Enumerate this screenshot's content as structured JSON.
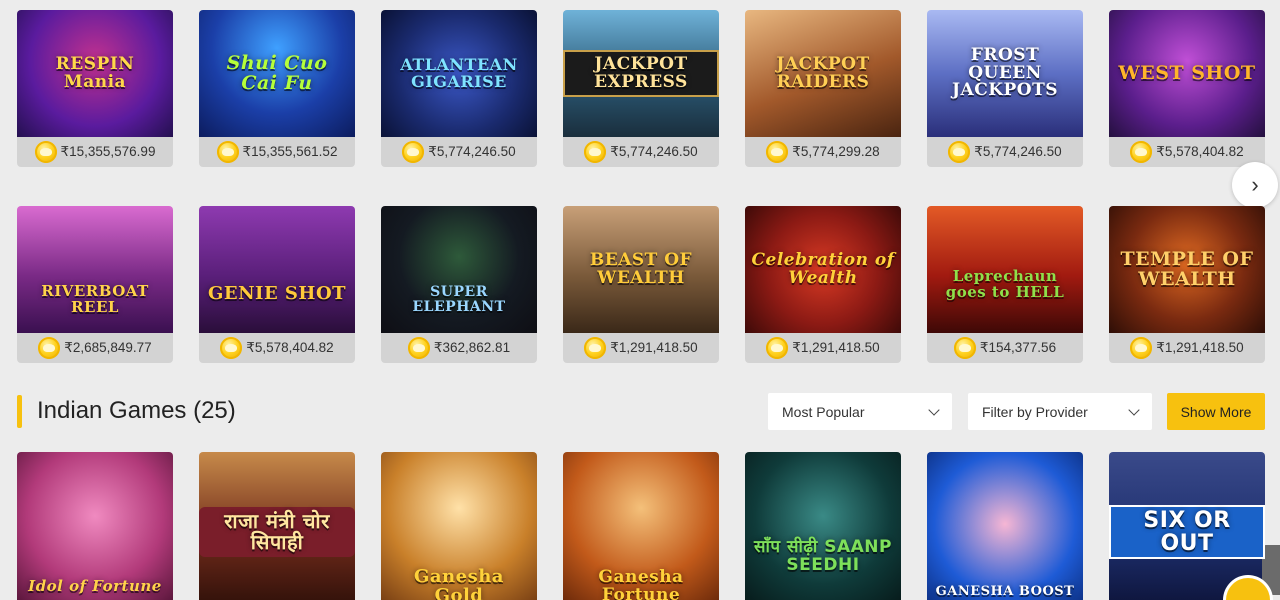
{
  "slots_row_1": [
    {
      "title": "RESPIN Mania",
      "jackpot": "₹15,355,576.99",
      "bg": "#6a1fb0"
    },
    {
      "title": "Shui Cuo Cai Fu",
      "jackpot": "₹15,355,561.52",
      "bg": "#1b3fa8"
    },
    {
      "title": "ATLANTEAN GIGARISE",
      "jackpot": "₹5,774,246.50",
      "bg": "#1a2a6e"
    },
    {
      "title": "JACKPOT EXPRESS",
      "jackpot": "₹5,774,246.50",
      "bg": "#2b5a77"
    },
    {
      "title": "JACKPOT RAIDERS",
      "jackpot": "₹5,774,299.28",
      "bg": "#a2592b"
    },
    {
      "title": "FROST QUEEN JACKPOTS",
      "jackpot": "₹5,774,246.50",
      "bg": "#5d6fc4"
    },
    {
      "title": "WEST SHOT",
      "jackpot": "₹5,578,404.82",
      "bg": "#5b1e8c"
    }
  ],
  "slots_row_2": [
    {
      "title": "RIVERBOAT REEL",
      "jackpot": "₹2,685,849.77",
      "bg": "#7a2a86"
    },
    {
      "title": "GENIE SHOT",
      "jackpot": "₹5,578,404.82",
      "bg": "#5a1f7a"
    },
    {
      "title": "SUPER ELEPHANT",
      "jackpot": "₹362,862.81",
      "bg": "#0e0e14"
    },
    {
      "title": "BEAST OF WEALTH",
      "jackpot": "₹1,291,418.50",
      "bg": "#7a5a3a"
    },
    {
      "title": "Celebration of Wealth",
      "jackpot": "₹1,291,418.50",
      "bg": "#8c1a14"
    },
    {
      "title": "Leprechaun goes to HELL",
      "jackpot": "₹154,377.56",
      "bg": "#a11a10"
    },
    {
      "title": "TEMPLE OF WEALTH",
      "jackpot": "₹1,291,418.50",
      "bg": "#7a2a10"
    }
  ],
  "section": {
    "title": "Indian Games (25)",
    "sort_label": "Most Popular",
    "provider_label": "Filter by Provider",
    "show_more": "Show More"
  },
  "indian_games": [
    {
      "title": "Idol of Fortune",
      "bg": "#b23a7a"
    },
    {
      "title": "राजा मंत्री चोर सिपाही",
      "bg": "#6e2a1a"
    },
    {
      "title": "Ganesha Gold",
      "bg": "#c9802a"
    },
    {
      "title": "Ganesha Fortune",
      "bg": "#c25a1a"
    },
    {
      "title": "साँप सीढ़ी SAANP SEEDHI",
      "bg": "#0f3b3a"
    },
    {
      "title": "GANESHA BOOST",
      "bg": "#1e5bd6"
    },
    {
      "title": "SIX OR OUT",
      "bg": "#1e2f6e"
    }
  ],
  "icons": {
    "next": "›"
  },
  "colors": {
    "accent": "#f7c10f",
    "tile_footer": "#d3d3d3",
    "page_bg": "#ececec"
  }
}
